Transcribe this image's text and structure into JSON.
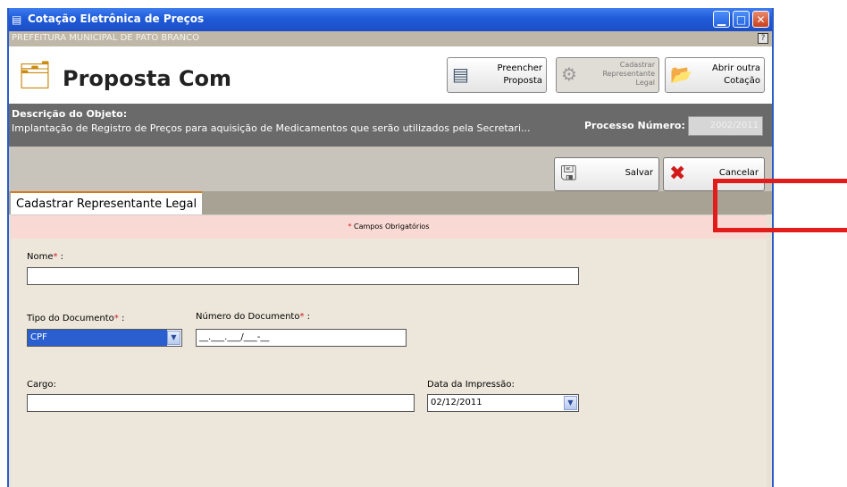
{
  "window": {
    "title": "Cotação Eletrônica de Preços",
    "organization": "PREFEITURA MUNICIPAL DE PATO BRANCO",
    "help_glyph": "?",
    "minimize_glyph": "▁",
    "maximize_glyph": "□",
    "close_glyph": "✕"
  },
  "header": {
    "title": "Proposta Com",
    "buttons": [
      {
        "label": "Preencher\nProposta",
        "icon": "form-icon",
        "enabled": true
      },
      {
        "label": "Cadastrar\nRepresentante\nLegal",
        "icon": "user-gear-icon",
        "enabled": false
      },
      {
        "label": "Abrir outra\nCotação",
        "icon": "folder-open-icon",
        "enabled": true
      }
    ]
  },
  "description": {
    "label": "Descrição do Objeto:",
    "text": "Implantação de Registro de Preços para aquisição de Medicamentos que serão utilizados pela Secretari...",
    "process_label": "Processo Número:",
    "process_value": "2002/2011"
  },
  "actions": {
    "save_label": "Salvar",
    "cancel_label": "Cancelar"
  },
  "tab": {
    "label": "Cadastrar Representante Legal"
  },
  "form": {
    "required_note": "Campos Obrigatórios",
    "required_mark": "*",
    "nome_label": "Nome",
    "nome_value": "",
    "tipo_doc_label": "Tipo do Documento",
    "tipo_doc_value": "CPF",
    "num_doc_label": "Número do Documento",
    "num_doc_value": "__.___.___/___-__",
    "cargo_label": "Cargo:",
    "cargo_value": "",
    "data_label": "Data da Impressão:",
    "data_value": "02/12/2011",
    "colon": " :"
  },
  "colors": {
    "title_bar": "#1f5ad8",
    "required": "#d21a1a",
    "annotation": "#e21b1b",
    "selected": "#2b5fcf"
  }
}
